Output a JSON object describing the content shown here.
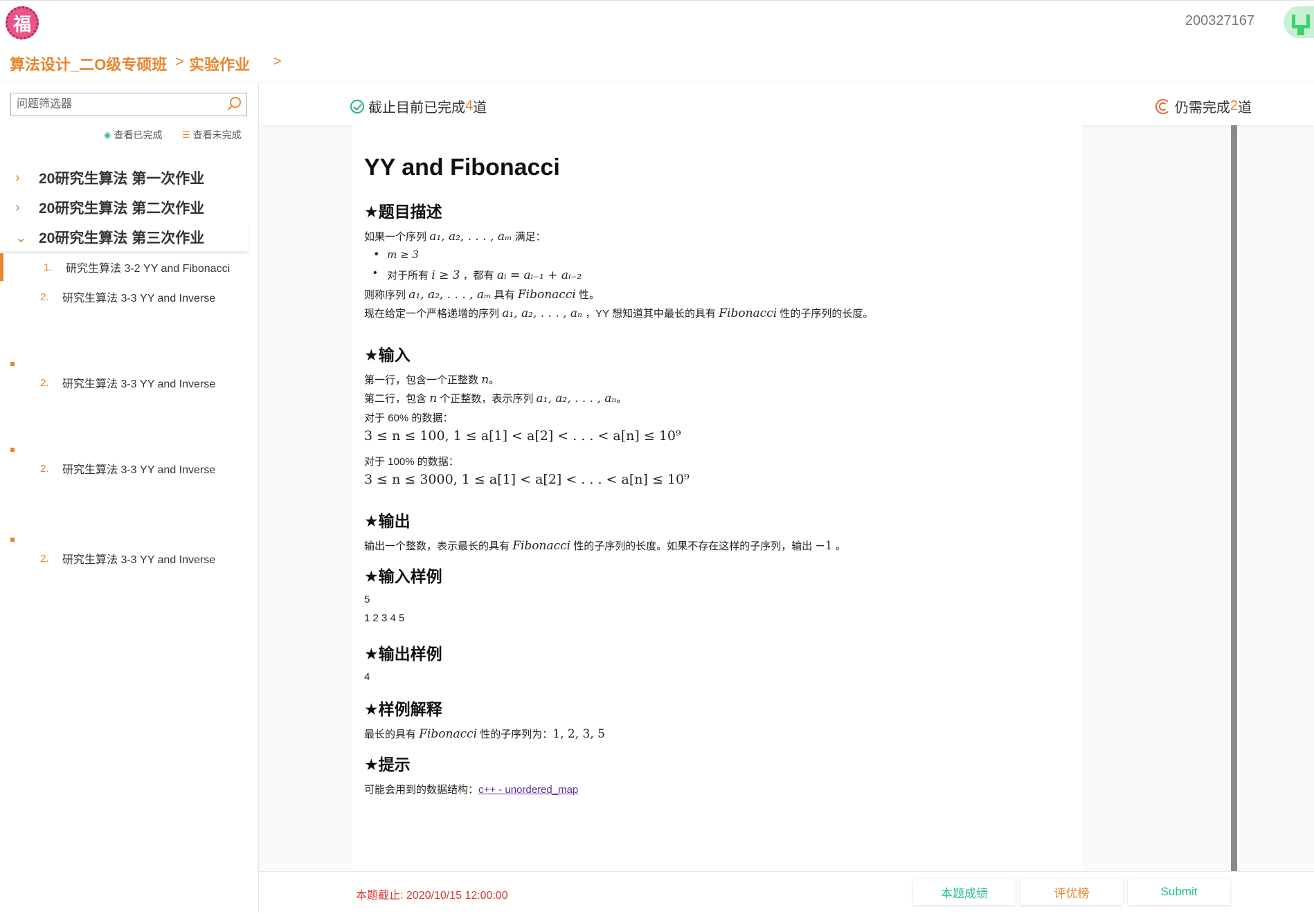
{
  "header": {
    "logo_char": "福",
    "user_id": "200327167"
  },
  "breadcrumb": {
    "course": "算法设计_二O级专硕班",
    "separator": ">",
    "section": "实验作业",
    "tail": ">"
  },
  "sidebar": {
    "filter_placeholder": "问题筛选器",
    "view_done": "查看已完成",
    "view_undone": "查看未完成",
    "groups": [
      {
        "label": "20研究生算法 第一次作业",
        "chevron": "›"
      },
      {
        "label": "20研究生算法 第二次作业",
        "chevron": "›"
      },
      {
        "label": "20研究生算法 第三次作业",
        "chevron": "⌄"
      }
    ],
    "problems": [
      {
        "num": "1.",
        "title": "研究生算法 3-2 YY and Fibonacci"
      },
      {
        "num": "2.",
        "title": "研究生算法 3-3 YY and Inverse"
      },
      {
        "num": "2.",
        "title": "研究生算法 3-3 YY and Inverse"
      },
      {
        "num": "2.",
        "title": "研究生算法 3-3 YY and Inverse"
      },
      {
        "num": "2.",
        "title": "研究生算法 3-3 YY and Inverse"
      }
    ]
  },
  "status": {
    "done_prefix": "截止目前已完成",
    "done_count": "4",
    "done_suffix": "道",
    "remain_prefix": "仍需完成",
    "remain_count": "2",
    "remain_suffix": "道"
  },
  "problem": {
    "title": "YY and Fibonacci",
    "h_desc": "★题目描述",
    "desc1_a": "如果一个序列",
    "desc1_math": "a₁, a₂, . . . , aₘ",
    "desc1_b": "满足：",
    "bullet1": "m ≥ 3",
    "bullet2_a": "对于所有",
    "bullet2_m1": "i ≥ 3",
    "bullet2_b": "，都有",
    "bullet2_m2": "aᵢ = aᵢ₋₁ + aᵢ₋₂",
    "desc2_a": "则称序列",
    "desc2_math": "a₁, a₂, . . . , aₘ",
    "desc2_b": "具有",
    "desc2_fib": "Fibonacci",
    "desc2_c": "性。",
    "desc3_a": "现在给定一个严格递增的序列",
    "desc3_math": "a₁, a₂, . . . , aₙ",
    "desc3_b": "，YY 想知道其中最长的具有",
    "desc3_fib": "Fibonacci",
    "desc3_c": "性的子序列的长度。",
    "h_input": "★输入",
    "in1_a": "第一行，包含一个正整数",
    "in1_m": "n",
    "in1_b": "。",
    "in2_a": "第二行，包含",
    "in2_m": "n",
    "in2_b": "个正整数，表示序列",
    "in2_math": "a₁, a₂, . . . , aₙ",
    "in2_c": "。",
    "in3": "对于 60% 的数据：",
    "in4": "3 ≤ n ≤ 100, 1 ≤ a[1] < a[2] < . . . < a[n] ≤ 10⁹",
    "in5": "对于 100% 的数据：",
    "in6": "3 ≤ n ≤ 3000, 1 ≤ a[1] < a[2] < . . . < a[n] ≤ 10⁹",
    "h_output": "★输出",
    "out_a": "输出一个整数，表示最长的具有",
    "out_fib": "Fibonacci",
    "out_b": "性的子序列的长度。如果不存在这样的子序列，输出",
    "out_m": "−1",
    "out_c": "。",
    "h_sample_in": "★输入样例",
    "sample_in1": "5",
    "sample_in2": "1 2 3 4 5",
    "h_sample_out": "★输出样例",
    "sample_out": "4",
    "h_explain": "★样例解释",
    "exp_a": "最长的具有",
    "exp_fib": "Fibonacci",
    "exp_b": "性的子序列为：",
    "exp_m": "1, 2, 3, 5",
    "h_hint": "★提示",
    "hint_a": "可能会用到的数据结构：",
    "hint_link": "c++ - unordered_map"
  },
  "footer": {
    "deadline": "本题截止: 2020/10/15 12:00:00",
    "btn_score": "本题成绩",
    "btn_rank": "评优榜",
    "btn_submit": "Submit",
    "colors": {
      "score": "#2bbf93",
      "rank": "#e8852f",
      "submit": "#2bbf93"
    }
  }
}
